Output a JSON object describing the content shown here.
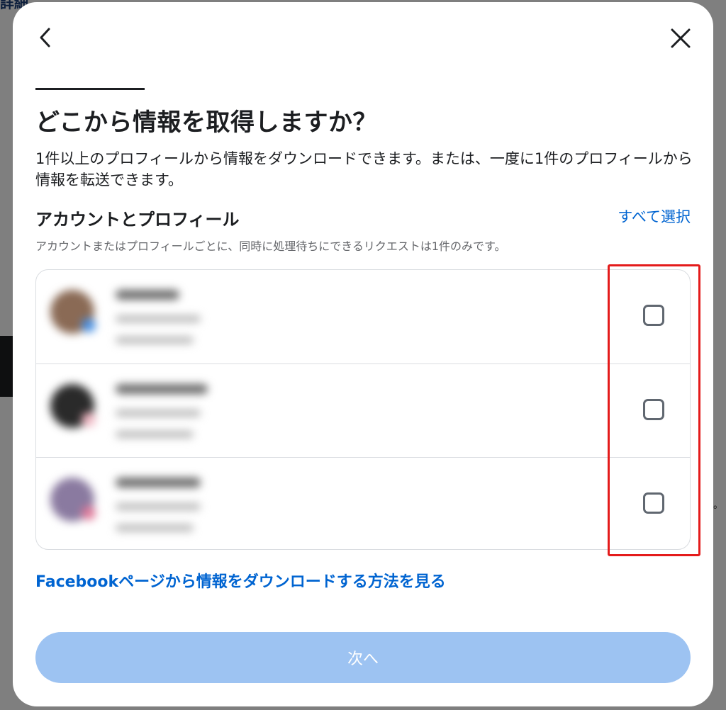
{
  "background": {
    "top_text": "詳細",
    "right_text": "。"
  },
  "modal": {
    "title": "どこから情報を取得しますか？",
    "description": "1件以上のプロフィールから情報をダウンロードできます。または、一度に1件のプロフィールから情報を転送できます。",
    "section": {
      "title": "アカウントとプロフィール",
      "select_all": "すべて選択",
      "subtitle": "アカウントまたはプロフィールごとに、同時に処理待ちにできるリクエストは1件のみです。"
    },
    "profiles": [
      {
        "checked": false,
        "avatar_color": "#8a6a55",
        "badge_color": "#4a90e2"
      },
      {
        "checked": false,
        "avatar_color": "#2a2a2a",
        "badge_color": "#f0b8c4"
      },
      {
        "checked": false,
        "avatar_color": "#8a7aa0",
        "badge_color": "#e07a9a"
      }
    ],
    "facebook_link": "Facebookページから情報をダウンロードする方法を見る",
    "next_button": "次へ",
    "next_button_enabled": false
  },
  "colors": {
    "accent": "#0064d1",
    "disabled_button": "#9dc3f2",
    "highlight": "#e41b1b",
    "text": "#1c1e21",
    "secondary_text": "#65676b"
  }
}
